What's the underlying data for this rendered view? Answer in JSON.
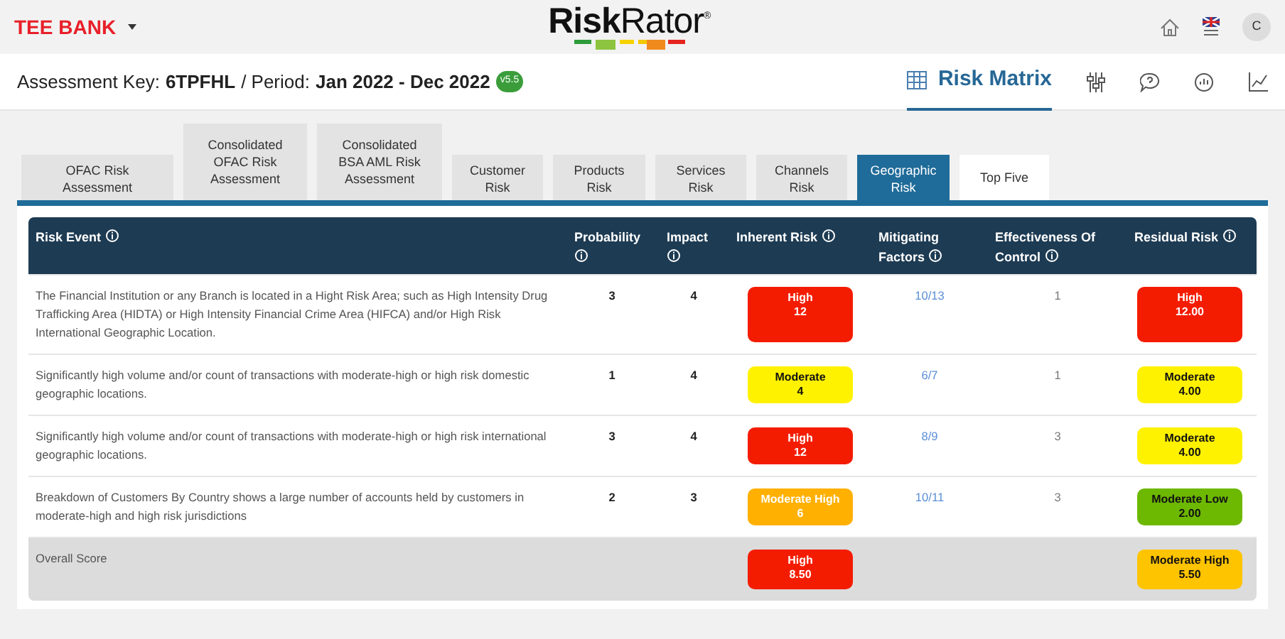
{
  "header": {
    "bank": "TEE BANK",
    "logo": "**Risk**Rator$^{®}$",
    "avatar": "C"
  },
  "subheader": {
    "key_label": "Assessment Key:",
    "key": "6TPFHL",
    "period_label": "/ Period:",
    "period": "Jan 2022 - Dec 2022",
    "version": "v5.5",
    "view": "Risk Matrix"
  },
  "tabs": [
    {
      "label": "OFAC Risk Assessment",
      "selected": false,
      "kind": "section"
    },
    {
      "label": "Consolidated OFAC Risk Assessment",
      "selected": false,
      "kind": "section"
    },
    {
      "label": "Consolidated BSA AML Risk Assessment",
      "selected": false,
      "kind": "section"
    },
    {
      "label": "Customer Risk",
      "selected": false,
      "kind": "section"
    },
    {
      "label": "Products Risk",
      "selected": false,
      "kind": "section"
    },
    {
      "label": "Services Risk",
      "selected": false,
      "kind": "section"
    },
    {
      "label": "Channels Risk",
      "selected": false,
      "kind": "section"
    },
    {
      "label": "Geographic Risk",
      "selected": true,
      "kind": "section"
    },
    {
      "label": "Top Five",
      "selected": false,
      "kind": "summary"
    }
  ],
  "table": {
    "columns": [
      "Risk Event",
      "Probability",
      "Impact",
      "Inherent Risk",
      "Mitigating Factors",
      "Effectiveness Of Control",
      "Residual Risk"
    ],
    "rows": [
      {
        "event": "The Financial Institution or any Branch is located in a Hight Risk Area; such as High Intensity Drug Trafficking Area (HIDTA) or High Intensity Financial Crime Area (HIFCA) and/or High Risk International Geographic Location.",
        "probability": "3",
        "impact": "4",
        "inherent": {
          "label": "High",
          "value": "12",
          "color": "#f41c00"
        },
        "mitigating": "10/13",
        "effectiveness": "1",
        "residual": {
          "label": "High",
          "value": "12.00",
          "color": "#f41c00"
        }
      },
      {
        "event": "Significantly high volume and/or count of transactions with moderate-high or high risk domestic geographic locations.",
        "probability": "1",
        "impact": "4",
        "inherent": {
          "label": "Moderate",
          "value": "4",
          "color": "#fff200"
        },
        "mitigating": "6/7",
        "effectiveness": "1",
        "residual": {
          "label": "Moderate",
          "value": "4.00",
          "color": "#fff200"
        }
      },
      {
        "event": "Significantly high volume and/or count of transactions with moderate-high or high risk international geographic locations.",
        "probability": "3",
        "impact": "4",
        "inherent": {
          "label": "High",
          "value": "12",
          "color": "#f41c00"
        },
        "mitigating": "8/9",
        "effectiveness": "3",
        "residual": {
          "label": "Moderate",
          "value": "4.00",
          "color": "#fff200"
        }
      },
      {
        "event": "Breakdown of Customers By Country shows a large number of accounts held by customers in moderate-high and high risk jurisdictions",
        "probability": "2",
        "impact": "3",
        "inherent": {
          "label": "Moderate High",
          "value": "6",
          "color": "#ffb000"
        },
        "mitigating": "10/11",
        "effectiveness": "3",
        "residual": {
          "label": "Moderate Low",
          "value": "2.00",
          "color": "#6db800"
        }
      }
    ],
    "overall": {
      "label": "Overall Score",
      "inherent": {
        "label": "High",
        "value": "8.50",
        "color": "#f41c00"
      },
      "residual": {
        "label": "Moderate High",
        "value": "5.50",
        "color": "#ffc400"
      }
    }
  }
}
